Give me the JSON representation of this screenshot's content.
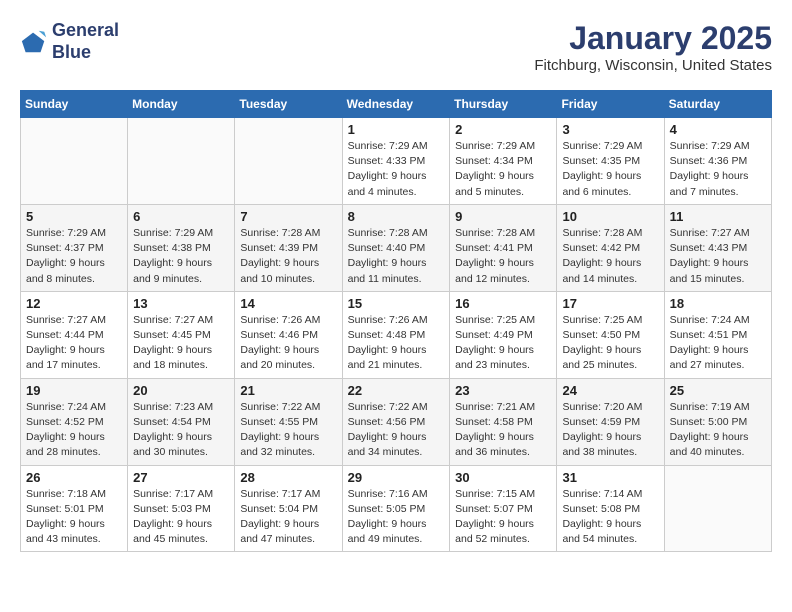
{
  "logo": {
    "line1": "General",
    "line2": "Blue"
  },
  "header": {
    "month": "January 2025",
    "location": "Fitchburg, Wisconsin, United States"
  },
  "weekdays": [
    "Sunday",
    "Monday",
    "Tuesday",
    "Wednesday",
    "Thursday",
    "Friday",
    "Saturday"
  ],
  "weeks": [
    [
      {
        "day": "",
        "info": ""
      },
      {
        "day": "",
        "info": ""
      },
      {
        "day": "",
        "info": ""
      },
      {
        "day": "1",
        "info": "Sunrise: 7:29 AM\nSunset: 4:33 PM\nDaylight: 9 hours\nand 4 minutes."
      },
      {
        "day": "2",
        "info": "Sunrise: 7:29 AM\nSunset: 4:34 PM\nDaylight: 9 hours\nand 5 minutes."
      },
      {
        "day": "3",
        "info": "Sunrise: 7:29 AM\nSunset: 4:35 PM\nDaylight: 9 hours\nand 6 minutes."
      },
      {
        "day": "4",
        "info": "Sunrise: 7:29 AM\nSunset: 4:36 PM\nDaylight: 9 hours\nand 7 minutes."
      }
    ],
    [
      {
        "day": "5",
        "info": "Sunrise: 7:29 AM\nSunset: 4:37 PM\nDaylight: 9 hours\nand 8 minutes."
      },
      {
        "day": "6",
        "info": "Sunrise: 7:29 AM\nSunset: 4:38 PM\nDaylight: 9 hours\nand 9 minutes."
      },
      {
        "day": "7",
        "info": "Sunrise: 7:28 AM\nSunset: 4:39 PM\nDaylight: 9 hours\nand 10 minutes."
      },
      {
        "day": "8",
        "info": "Sunrise: 7:28 AM\nSunset: 4:40 PM\nDaylight: 9 hours\nand 11 minutes."
      },
      {
        "day": "9",
        "info": "Sunrise: 7:28 AM\nSunset: 4:41 PM\nDaylight: 9 hours\nand 12 minutes."
      },
      {
        "day": "10",
        "info": "Sunrise: 7:28 AM\nSunset: 4:42 PM\nDaylight: 9 hours\nand 14 minutes."
      },
      {
        "day": "11",
        "info": "Sunrise: 7:27 AM\nSunset: 4:43 PM\nDaylight: 9 hours\nand 15 minutes."
      }
    ],
    [
      {
        "day": "12",
        "info": "Sunrise: 7:27 AM\nSunset: 4:44 PM\nDaylight: 9 hours\nand 17 minutes."
      },
      {
        "day": "13",
        "info": "Sunrise: 7:27 AM\nSunset: 4:45 PM\nDaylight: 9 hours\nand 18 minutes."
      },
      {
        "day": "14",
        "info": "Sunrise: 7:26 AM\nSunset: 4:46 PM\nDaylight: 9 hours\nand 20 minutes."
      },
      {
        "day": "15",
        "info": "Sunrise: 7:26 AM\nSunset: 4:48 PM\nDaylight: 9 hours\nand 21 minutes."
      },
      {
        "day": "16",
        "info": "Sunrise: 7:25 AM\nSunset: 4:49 PM\nDaylight: 9 hours\nand 23 minutes."
      },
      {
        "day": "17",
        "info": "Sunrise: 7:25 AM\nSunset: 4:50 PM\nDaylight: 9 hours\nand 25 minutes."
      },
      {
        "day": "18",
        "info": "Sunrise: 7:24 AM\nSunset: 4:51 PM\nDaylight: 9 hours\nand 27 minutes."
      }
    ],
    [
      {
        "day": "19",
        "info": "Sunrise: 7:24 AM\nSunset: 4:52 PM\nDaylight: 9 hours\nand 28 minutes."
      },
      {
        "day": "20",
        "info": "Sunrise: 7:23 AM\nSunset: 4:54 PM\nDaylight: 9 hours\nand 30 minutes."
      },
      {
        "day": "21",
        "info": "Sunrise: 7:22 AM\nSunset: 4:55 PM\nDaylight: 9 hours\nand 32 minutes."
      },
      {
        "day": "22",
        "info": "Sunrise: 7:22 AM\nSunset: 4:56 PM\nDaylight: 9 hours\nand 34 minutes."
      },
      {
        "day": "23",
        "info": "Sunrise: 7:21 AM\nSunset: 4:58 PM\nDaylight: 9 hours\nand 36 minutes."
      },
      {
        "day": "24",
        "info": "Sunrise: 7:20 AM\nSunset: 4:59 PM\nDaylight: 9 hours\nand 38 minutes."
      },
      {
        "day": "25",
        "info": "Sunrise: 7:19 AM\nSunset: 5:00 PM\nDaylight: 9 hours\nand 40 minutes."
      }
    ],
    [
      {
        "day": "26",
        "info": "Sunrise: 7:18 AM\nSunset: 5:01 PM\nDaylight: 9 hours\nand 43 minutes."
      },
      {
        "day": "27",
        "info": "Sunrise: 7:17 AM\nSunset: 5:03 PM\nDaylight: 9 hours\nand 45 minutes."
      },
      {
        "day": "28",
        "info": "Sunrise: 7:17 AM\nSunset: 5:04 PM\nDaylight: 9 hours\nand 47 minutes."
      },
      {
        "day": "29",
        "info": "Sunrise: 7:16 AM\nSunset: 5:05 PM\nDaylight: 9 hours\nand 49 minutes."
      },
      {
        "day": "30",
        "info": "Sunrise: 7:15 AM\nSunset: 5:07 PM\nDaylight: 9 hours\nand 52 minutes."
      },
      {
        "day": "31",
        "info": "Sunrise: 7:14 AM\nSunset: 5:08 PM\nDaylight: 9 hours\nand 54 minutes."
      },
      {
        "day": "",
        "info": ""
      }
    ]
  ]
}
